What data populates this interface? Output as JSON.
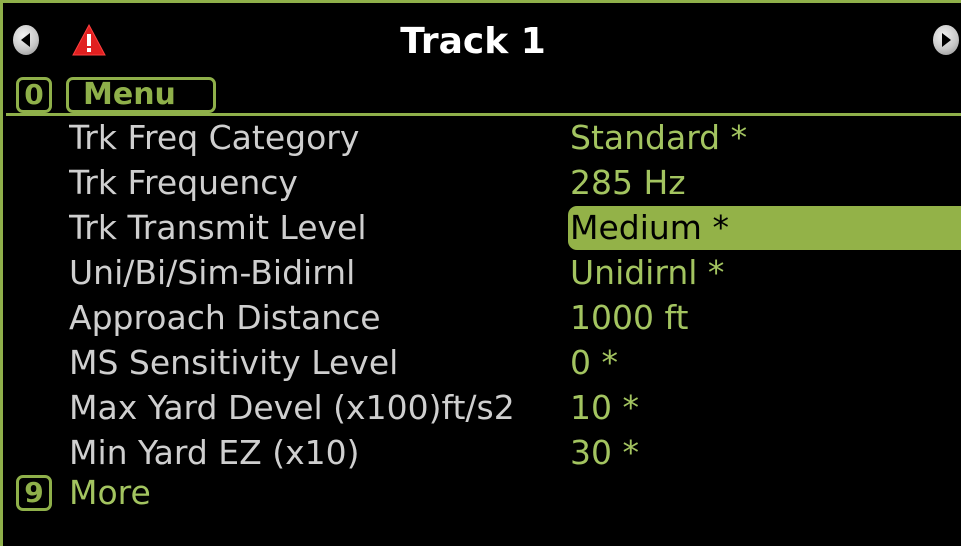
{
  "header": {
    "title": "Track 1",
    "left_arrow_icon": "left-arrow-icon",
    "right_arrow_icon": "right-arrow-icon",
    "warning_icon": "warning-icon"
  },
  "menu": {
    "key": "0",
    "label": "Menu"
  },
  "settings": [
    {
      "label": "Trk Freq Category",
      "value": "Standard *"
    },
    {
      "label": "Trk Frequency",
      "value": "285 Hz"
    },
    {
      "label": "Trk Transmit Level",
      "value": "Medium *"
    },
    {
      "label": "Uni/Bi/Sim-Bidirnl",
      "value": "Unidirnl *"
    },
    {
      "label": "Approach Distance",
      "value": "1000 ft"
    },
    {
      "label": "MS Sensitivity Level",
      "value": "0  *"
    },
    {
      "label": "Max Yard Devel (x100)ft/s2",
      "value": "10  *"
    },
    {
      "label": "Min Yard EZ (x10)",
      "value": "30  *"
    }
  ],
  "more": {
    "key": "9",
    "label": "More"
  },
  "colors": {
    "accent": "#8fb04a",
    "value_text": "#a3c460",
    "label_text": "#cfcfcf",
    "selected_bg": "#93b248",
    "warning": "#e02020"
  }
}
